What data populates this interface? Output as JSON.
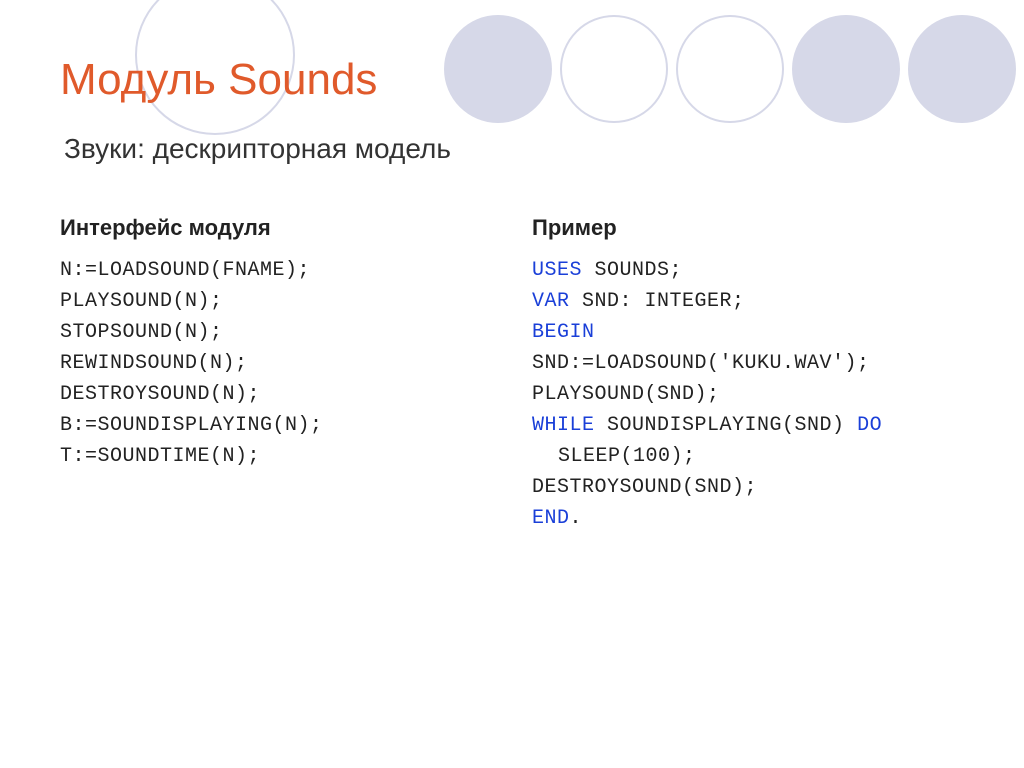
{
  "title": "Модуль Sounds",
  "subtitle": "Звуки: дескрипторная модель",
  "left": {
    "heading": "Интерфейс модуля",
    "lines": [
      "N:=LOADSOUND(FNAME);",
      "PLAYSOUND(N);",
      "STOPSOUND(N);",
      "REWINDSOUND(N);",
      "DESTROYSOUND(N);",
      "B:=SOUNDISPLAYING(N);",
      "T:=SOUNDTIME(N);"
    ]
  },
  "right": {
    "heading": "Пример",
    "tokens": {
      "kw_uses": "USES",
      "t_sounds": " SOUNDS;",
      "kw_var": "VAR",
      "t_decl": " SND: INTEGER;",
      "kw_begin": "BEGIN",
      "t_load": "SND:=LOADSOUND('KUKU.WAV');",
      "t_play": "PLAYSOUND(SND);",
      "kw_while": "WHILE",
      "t_cond": " SOUNDISPLAYING(SND) ",
      "kw_do": "DO",
      "t_sleep": "SLEEP(100);",
      "t_destroy": "DESTROYSOUND(SND);",
      "kw_end": "END",
      "t_dot": "."
    }
  }
}
